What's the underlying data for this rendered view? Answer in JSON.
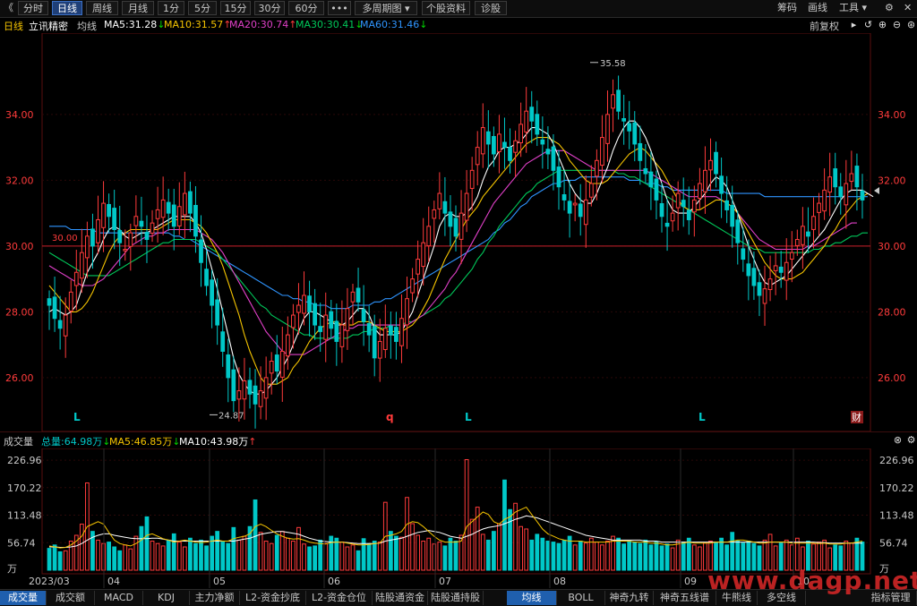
{
  "toolbar": {
    "back": "《",
    "buttons": [
      "分时",
      "日线",
      "周线",
      "月线",
      "1分",
      "5分",
      "15分",
      "30分",
      "60分",
      "•••",
      "多周期图 ▾",
      "个股资料",
      "诊股"
    ],
    "active": "日线",
    "right": [
      "筹码",
      "画线",
      "工具 ▾"
    ],
    "icons": {
      "settings": "⚙",
      "restore": "⧉",
      "close": "✕"
    }
  },
  "header": {
    "period": "日线",
    "stock": "立讯精密",
    "ma_label": "均线",
    "ma": [
      {
        "text": "MA5:31.28",
        "arrow": "↓",
        "color": "#ffffff",
        "arrow_color": "#00d100"
      },
      {
        "text": "MA10:31.57",
        "arrow": "↑",
        "color": "#f5c400",
        "arrow_color": "#ff3b3b"
      },
      {
        "text": "MA20:30.74",
        "arrow": "↑",
        "color": "#e040c8",
        "arrow_color": "#ff3b3b"
      },
      {
        "text": "MA30:30.41",
        "arrow": "↓",
        "color": "#00c85a",
        "arrow_color": "#00d100"
      },
      {
        "text": "MA60:31.46",
        "arrow": "↓",
        "color": "#2f95ff",
        "arrow_color": "#00d100"
      }
    ],
    "adjust": "前复权"
  },
  "price_axis": {
    "left_labels": [
      "34.00",
      "32.00",
      "30.00",
      "28.00",
      "26.00"
    ],
    "right_labels": [
      "34.00",
      "32.00",
      "30.00",
      "28.00",
      "26.00"
    ],
    "ref_label": "30.00",
    "high_label": "35.58",
    "low_label": "24.87"
  },
  "markers": {
    "left_letters": [
      "L",
      "q",
      "L",
      "L"
    ],
    "fin": "财"
  },
  "volume": {
    "title": "成交量",
    "total": "总量:64.98万",
    "total_arrow": "↓",
    "ma5": "MA5:46.85万",
    "ma5_arrow": "↓",
    "ma10": "MA10:43.98万",
    "ma10_arrow": "↑",
    "axis_labels": [
      "226.96",
      "170.22",
      "113.48",
      "56.74",
      "万"
    ]
  },
  "dates": [
    "2023/03",
    "04",
    "05",
    "06",
    "07",
    "08",
    "09",
    "10"
  ],
  "bottom_tabs_left": [
    "成交量",
    "成交额",
    "MACD",
    "KDJ",
    "主力净额",
    "L2-资金抄底",
    "L2-资金仓位",
    "陆股通资金",
    "陆股通持股"
  ],
  "bottom_tabs_right": [
    "均线",
    "BOLL",
    "神奇九转",
    "神奇五线谱",
    "牛熊线",
    "多空线"
  ],
  "bottom_right": "指标管理",
  "watermark": "www.dagp.net",
  "chart_data": {
    "type": "candlestick",
    "title": "立讯精密 日线",
    "ylim": [
      24.5,
      36.2
    ],
    "volume_ylim": [
      0,
      240
    ],
    "up_color": "#ff3b3b",
    "down_color": "#00c8c8",
    "reference_price": 30.0,
    "closes": [
      28.2,
      27.8,
      27.5,
      27.9,
      28.6,
      29.2,
      29.8,
      30.3,
      30.0,
      30.8,
      31.3,
      30.9,
      30.5,
      30.1,
      29.9,
      30.4,
      30.9,
      30.6,
      30.2,
      30.7,
      31.1,
      31.4,
      31.0,
      30.6,
      31.2,
      31.6,
      31.0,
      30.3,
      29.5,
      28.8,
      28.2,
      27.6,
      26.8,
      26.0,
      25.3,
      25.6,
      25.9,
      25.5,
      25.2,
      25.6,
      26.0,
      26.5,
      26.2,
      26.8,
      27.3,
      27.9,
      28.2,
      28.5,
      28.0,
      27.6,
      27.4,
      27.9,
      27.5,
      27.1,
      27.6,
      28.1,
      28.6,
      28.3,
      27.7,
      27.3,
      26.6,
      27.1,
      27.5,
      27.3,
      27.1,
      27.8,
      28.4,
      29.0,
      29.6,
      30.1,
      30.6,
      31.1,
      31.6,
      31.0,
      30.6,
      30.3,
      31.0,
      31.6,
      32.3,
      33.0,
      33.6,
      33.1,
      32.8,
      33.4,
      33.0,
      32.6,
      33.2,
      33.7,
      34.1,
      33.8,
      33.4,
      33.1,
      32.8,
      32.3,
      31.8,
      31.4,
      31.0,
      31.3,
      30.9,
      31.4,
      31.9,
      32.6,
      33.3,
      34.0,
      34.6,
      34.1,
      33.8,
      33.5,
      33.1,
      32.6,
      32.2,
      31.8,
      31.4,
      30.9,
      30.6,
      31.0,
      31.6,
      31.2,
      30.8,
      31.4,
      31.9,
      32.3,
      32.6,
      32.2,
      31.6,
      31.1,
      30.6,
      30.1,
      29.6,
      29.1,
      28.8,
      28.5,
      28.7,
      29.0,
      29.4,
      29.2,
      29.5,
      29.8,
      30.2,
      30.6,
      30.3,
      30.9,
      31.3,
      31.7,
      32.1,
      31.8,
      31.5,
      31.9,
      32.2,
      31.8,
      31.4
    ],
    "ma5": [
      28.0,
      28.1,
      28.0,
      27.9,
      28.0,
      28.2,
      28.7,
      29.2,
      29.5,
      29.8,
      30.2,
      30.5,
      30.6,
      30.5,
      30.3,
      30.2,
      30.3,
      30.4,
      30.4,
      30.5,
      30.6,
      30.7,
      30.8,
      30.9,
      30.9,
      30.9,
      30.9,
      30.7,
      30.4,
      29.9,
      29.3,
      28.7,
      28.0,
      27.3,
      26.6,
      26.1,
      25.8,
      25.6,
      25.5,
      25.5,
      25.6,
      25.8,
      26.0,
      26.3,
      26.6,
      27.0,
      27.4,
      27.8,
      28.0,
      28.0,
      27.9,
      27.8,
      27.7,
      27.6,
      27.6,
      27.7,
      27.9,
      28.1,
      28.1,
      27.9,
      27.5,
      27.3,
      27.3,
      27.3,
      27.3,
      27.4,
      27.7,
      28.0,
      28.5,
      29.0,
      29.5,
      30.0,
      30.6,
      30.9,
      31.0,
      30.9,
      30.9,
      31.0,
      31.2,
      31.5,
      32.0,
      32.4,
      32.6,
      32.9,
      33.0,
      33.0,
      33.1,
      33.2,
      33.4,
      33.6,
      33.6,
      33.5,
      33.4,
      33.1,
      32.7,
      32.3,
      31.9,
      31.6,
      31.4,
      31.3,
      31.3,
      31.6,
      32.0,
      32.4,
      32.9,
      33.3,
      33.6,
      33.8,
      33.8,
      33.6,
      33.3,
      32.9,
      32.4,
      31.9,
      31.4,
      31.1,
      31.0,
      31.0,
      31.0,
      31.2,
      31.4,
      31.6,
      31.9,
      32.1,
      32.0,
      31.8,
      31.4,
      31.0,
      30.5,
      30.0,
      29.6,
      29.2,
      28.9,
      28.8,
      28.9,
      29.0,
      29.1,
      29.3,
      29.5,
      29.7,
      29.9,
      30.1,
      30.3,
      30.5,
      30.8,
      31.1,
      31.4,
      31.6,
      31.7,
      31.7,
      31.7,
      31.6,
      31.5
    ],
    "ma10": [
      28.8,
      28.6,
      28.4,
      28.2,
      28.0,
      28.0,
      28.1,
      28.3,
      28.6,
      29.0,
      29.4,
      29.8,
      30.1,
      30.3,
      30.4,
      30.5,
      30.5,
      30.5,
      30.5,
      30.5,
      30.5,
      30.6,
      30.7,
      30.8,
      30.8,
      30.8,
      30.8,
      30.7,
      30.6,
      30.4,
      30.1,
      29.8,
      29.4,
      28.9,
      28.4,
      27.9,
      27.3,
      26.8,
      26.4,
      26.0,
      25.8,
      25.8,
      25.8,
      25.9,
      26.0,
      26.3,
      26.5,
      26.8,
      27.1,
      27.3,
      27.5,
      27.6,
      27.7,
      27.7,
      27.6,
      27.6,
      27.6,
      27.7,
      27.7,
      27.7,
      27.6,
      27.5,
      27.4,
      27.4,
      27.4,
      27.4,
      27.5,
      27.6,
      27.8,
      28.1,
      28.4,
      28.8,
      29.2,
      29.6,
      29.9,
      30.2,
      30.5,
      30.8,
      31.0,
      31.2,
      31.5,
      31.7,
      31.9,
      32.1,
      32.3,
      32.5,
      32.7,
      32.9,
      33.1,
      33.2,
      33.3,
      33.3,
      33.3,
      33.2,
      33.1,
      32.9,
      32.6,
      32.4,
      32.2,
      32.0,
      31.9,
      31.9,
      31.9,
      32.0,
      32.2,
      32.4,
      32.6,
      32.8,
      32.9,
      33.0,
      32.9,
      32.7,
      32.5,
      32.3,
      32.0,
      31.7,
      31.4,
      31.2,
      31.1,
      31.1,
      31.1,
      31.2,
      31.3,
      31.4,
      31.4,
      31.3,
      31.2,
      31.0,
      30.7,
      30.4,
      30.1,
      29.8,
      29.5,
      29.3,
      29.1,
      29.0,
      29.0,
      29.0,
      29.1,
      29.2,
      29.4,
      29.6,
      29.8,
      30.0,
      30.3,
      30.5,
      30.8,
      31.0,
      31.2,
      31.4,
      31.5,
      31.6
    ],
    "ma20": [
      29.4,
      29.3,
      29.2,
      29.1,
      29.0,
      28.9,
      28.8,
      28.8,
      28.8,
      28.9,
      29.0,
      29.2,
      29.4,
      29.6,
      29.8,
      30.0,
      30.1,
      30.2,
      30.3,
      30.3,
      30.4,
      30.4,
      30.5,
      30.5,
      30.5,
      30.5,
      30.5,
      30.5,
      30.4,
      30.3,
      30.2,
      30.0,
      29.8,
      29.5,
      29.2,
      28.9,
      28.6,
      28.3,
      28.0,
      27.7,
      27.4,
      27.2,
      27.0,
      26.8,
      26.7,
      26.7,
      26.7,
      26.7,
      26.8,
      26.9,
      27.0,
      27.1,
      27.2,
      27.3,
      27.4,
      27.5,
      27.5,
      27.6,
      27.6,
      27.6,
      27.6,
      27.6,
      27.6,
      27.6,
      27.6,
      27.6,
      27.6,
      27.7,
      27.8,
      27.9,
      28.1,
      28.3,
      28.5,
      28.7,
      29.0,
      29.2,
      29.5,
      29.8,
      30.1,
      30.4,
      30.7,
      31.0,
      31.3,
      31.5,
      31.7,
      31.9,
      32.1,
      32.3,
      32.5,
      32.6,
      32.7,
      32.8,
      32.9,
      32.9,
      32.9,
      32.9,
      32.8,
      32.7,
      32.6,
      32.5,
      32.4,
      32.3,
      32.3,
      32.3,
      32.3,
      32.3,
      32.3,
      32.3,
      32.3,
      32.3,
      32.3,
      32.2,
      32.1,
      32.0,
      31.9,
      31.8,
      31.7,
      31.6,
      31.5,
      31.5,
      31.5,
      31.5,
      31.5,
      31.5,
      31.4,
      31.3,
      31.2,
      31.0,
      30.8,
      30.6,
      30.4,
      30.2,
      30.1,
      30.0,
      29.9,
      29.9,
      29.9,
      29.9,
      29.9,
      29.9,
      30.0,
      30.0,
      30.1,
      30.2,
      30.3,
      30.4,
      30.5,
      30.6,
      30.7,
      30.7
    ],
    "ma30": [
      29.8,
      29.7,
      29.6,
      29.5,
      29.4,
      29.3,
      29.2,
      29.1,
      29.1,
      29.1,
      29.1,
      29.1,
      29.2,
      29.3,
      29.4,
      29.5,
      29.6,
      29.7,
      29.8,
      29.9,
      30.0,
      30.1,
      30.1,
      30.2,
      30.2,
      30.2,
      30.2,
      30.2,
      30.1,
      30.0,
      29.9,
      29.8,
      29.6,
      29.4,
      29.2,
      29.0,
      28.8,
      28.6,
      28.4,
      28.2,
      28.1,
      27.9,
      27.8,
      27.7,
      27.6,
      27.5,
      27.4,
      27.3,
      27.3,
      27.2,
      27.2,
      27.2,
      27.2,
      27.2,
      27.2,
      27.2,
      27.3,
      27.3,
      27.4,
      27.4,
      27.5,
      27.5,
      27.5,
      27.6,
      27.6,
      27.6,
      27.7,
      27.7,
      27.8,
      27.9,
      28.0,
      28.1,
      28.2,
      28.4,
      28.5,
      28.7,
      28.9,
      29.1,
      29.3,
      29.6,
      29.8,
      30.1,
      30.3,
      30.6,
      30.8,
      31.0,
      31.2,
      31.4,
      31.6,
      31.7,
      31.9,
      32.0,
      32.1,
      32.2,
      32.3,
      32.3,
      32.3,
      32.3,
      32.3,
      32.3,
      32.3,
      32.3,
      32.3,
      32.3,
      32.3,
      32.2,
      32.2,
      32.1,
      32.1,
      32.0,
      31.9,
      31.8,
      31.7,
      31.6,
      31.5,
      31.4,
      31.3,
      31.2,
      31.1,
      31.0,
      30.9,
      30.8,
      30.7,
      30.6,
      30.5,
      30.4,
      30.3,
      30.2,
      30.1,
      30.0,
      29.9,
      29.9,
      29.8,
      29.8,
      29.8,
      29.8,
      29.8,
      29.8,
      29.8,
      29.8,
      29.8,
      29.9,
      29.9,
      30.0,
      30.0,
      30.1,
      30.1,
      30.2,
      30.3,
      30.3,
      30.4,
      30.4
    ],
    "ma60": [
      30.6,
      30.6,
      30.6,
      30.6,
      30.5,
      30.5,
      30.5,
      30.5,
      30.5,
      30.4,
      30.4,
      30.4,
      30.4,
      30.4,
      30.4,
      30.4,
      30.4,
      30.4,
      30.4,
      30.4,
      30.4,
      30.4,
      30.4,
      30.3,
      30.3,
      30.2,
      30.2,
      30.1,
      30.0,
      29.9,
      29.8,
      29.7,
      29.6,
      29.5,
      29.4,
      29.3,
      29.2,
      29.1,
      29.0,
      28.9,
      28.8,
      28.7,
      28.6,
      28.5,
      28.5,
      28.4,
      28.4,
      28.3,
      28.3,
      28.2,
      28.2,
      28.2,
      28.1,
      28.1,
      28.1,
      28.1,
      28.2,
      28.2,
      28.2,
      28.2,
      28.3,
      28.3,
      28.4,
      28.4,
      28.5,
      28.6,
      28.7,
      28.8,
      28.9,
      29.0,
      29.1,
      29.2,
      29.3,
      29.4,
      29.5,
      29.6,
      29.7,
      29.8,
      29.9,
      30.0,
      30.1,
      30.2,
      30.4,
      30.5,
      30.7,
      30.8,
      31.0,
      31.2,
      31.3,
      31.5,
      31.6,
      31.7,
      31.8,
      31.9,
      31.9,
      32.0,
      32.0,
      32.0,
      32.1,
      32.1,
      32.1,
      32.1,
      32.1,
      32.1,
      32.1,
      32.1,
      32.1,
      32.0,
      32.0,
      32.0,
      31.9,
      31.9,
      31.9,
      31.8,
      31.8,
      31.7,
      31.7,
      31.7,
      31.7,
      31.7,
      31.7,
      31.7,
      31.7,
      31.7,
      31.7,
      31.6,
      31.6,
      31.6,
      31.6,
      31.6,
      31.6,
      31.6,
      31.5,
      31.5,
      31.5,
      31.5,
      31.5,
      31.5,
      31.5,
      31.5,
      31.5,
      31.5,
      31.5,
      31.5,
      31.5,
      31.5,
      31.5,
      31.5,
      31.5,
      31.5,
      31.5,
      31.5
    ],
    "volumes": [
      45,
      52,
      38,
      40,
      60,
      72,
      95,
      180,
      80,
      62,
      55,
      58,
      48,
      40,
      52,
      44,
      70,
      90,
      110,
      60,
      55,
      50,
      62,
      75,
      58,
      48,
      66,
      55,
      62,
      50,
      70,
      80,
      58,
      55,
      88,
      62,
      70,
      90,
      145,
      78,
      60,
      55,
      72,
      80,
      66,
      60,
      88,
      54,
      48,
      50,
      62,
      55,
      70,
      66,
      58,
      48,
      52,
      40,
      65,
      55,
      60,
      58,
      140,
      80,
      70,
      68,
      150,
      96,
      72,
      60,
      66,
      54,
      58,
      50,
      66,
      60,
      72,
      228,
      105,
      130,
      74,
      62,
      80,
      96,
      186,
      125,
      138,
      90,
      85,
      62,
      74,
      66,
      60,
      58,
      55,
      62,
      70,
      52,
      60,
      56,
      66,
      58,
      52,
      60,
      70,
      66,
      54,
      60,
      58,
      55,
      62,
      52,
      58,
      50,
      54,
      46,
      62,
      58,
      66,
      52,
      48,
      56,
      60,
      58,
      66,
      52,
      78,
      60,
      56,
      60,
      55,
      50,
      62,
      74,
      50,
      56,
      62,
      52,
      66,
      48,
      60,
      54,
      58,
      62,
      46,
      52,
      50,
      60,
      56,
      66,
      58,
      74,
      70
    ],
    "volume_ma5": [
      50,
      48,
      46,
      47,
      52,
      60,
      70,
      90,
      95,
      100,
      95,
      78,
      62,
      55,
      52,
      50,
      55,
      62,
      72,
      75,
      70,
      65,
      62,
      58,
      60,
      62,
      60,
      58,
      57,
      58,
      60,
      62,
      60,
      60,
      65,
      68,
      70,
      75,
      90,
      95,
      90,
      82,
      75,
      70,
      66,
      64,
      65,
      62,
      58,
      56,
      55,
      54,
      57,
      58,
      58,
      56,
      54,
      52,
      52,
      53,
      55,
      56,
      70,
      72,
      75,
      80,
      95,
      100,
      98,
      90,
      80,
      70,
      62,
      58,
      58,
      58,
      60,
      90,
      100,
      110,
      120,
      115,
      100,
      95,
      105,
      110,
      120,
      125,
      130,
      115,
      100,
      85,
      75,
      70,
      65,
      62,
      60,
      60,
      60,
      58,
      58,
      58,
      58,
      58,
      60,
      60,
      60,
      60,
      58,
      58,
      58,
      56,
      56,
      54,
      52,
      52,
      54,
      56,
      58,
      56,
      56,
      56,
      56,
      58,
      58,
      58,
      60,
      62,
      62,
      60,
      58,
      56,
      56,
      58,
      58,
      58,
      58,
      56,
      56,
      56,
      56,
      56,
      55,
      56,
      54,
      54,
      54,
      56,
      56,
      58,
      60,
      62,
      64
    ],
    "volume_ma10": [
      48,
      48,
      47,
      47,
      48,
      50,
      55,
      62,
      68,
      72,
      75,
      75,
      72,
      70,
      68,
      66,
      65,
      65,
      65,
      66,
      66,
      64,
      62,
      60,
      60,
      60,
      60,
      60,
      60,
      60,
      60,
      60,
      60,
      60,
      60,
      62,
      64,
      66,
      70,
      74,
      76,
      78,
      80,
      80,
      78,
      76,
      74,
      70,
      66,
      63,
      60,
      59,
      58,
      58,
      58,
      57,
      56,
      55,
      55,
      55,
      55,
      56,
      60,
      62,
      64,
      66,
      70,
      74,
      78,
      80,
      82,
      80,
      78,
      74,
      70,
      68,
      66,
      70,
      74,
      80,
      85,
      88,
      90,
      92,
      96,
      100,
      105,
      108,
      112,
      110,
      108,
      104,
      100,
      96,
      92,
      88,
      84,
      80,
      76,
      72,
      70,
      68,
      66,
      64,
      62,
      62,
      62,
      62,
      62,
      62,
      60,
      60,
      60,
      58,
      58,
      58,
      58,
      58,
      58,
      58,
      58,
      58,
      58,
      58,
      58,
      58,
      58,
      58,
      58,
      58,
      58,
      58,
      58,
      58,
      58,
      58,
      58,
      58,
      58,
      58,
      58,
      58,
      57,
      57,
      56,
      56,
      56,
      56,
      56,
      56,
      56,
      57,
      58
    ]
  }
}
